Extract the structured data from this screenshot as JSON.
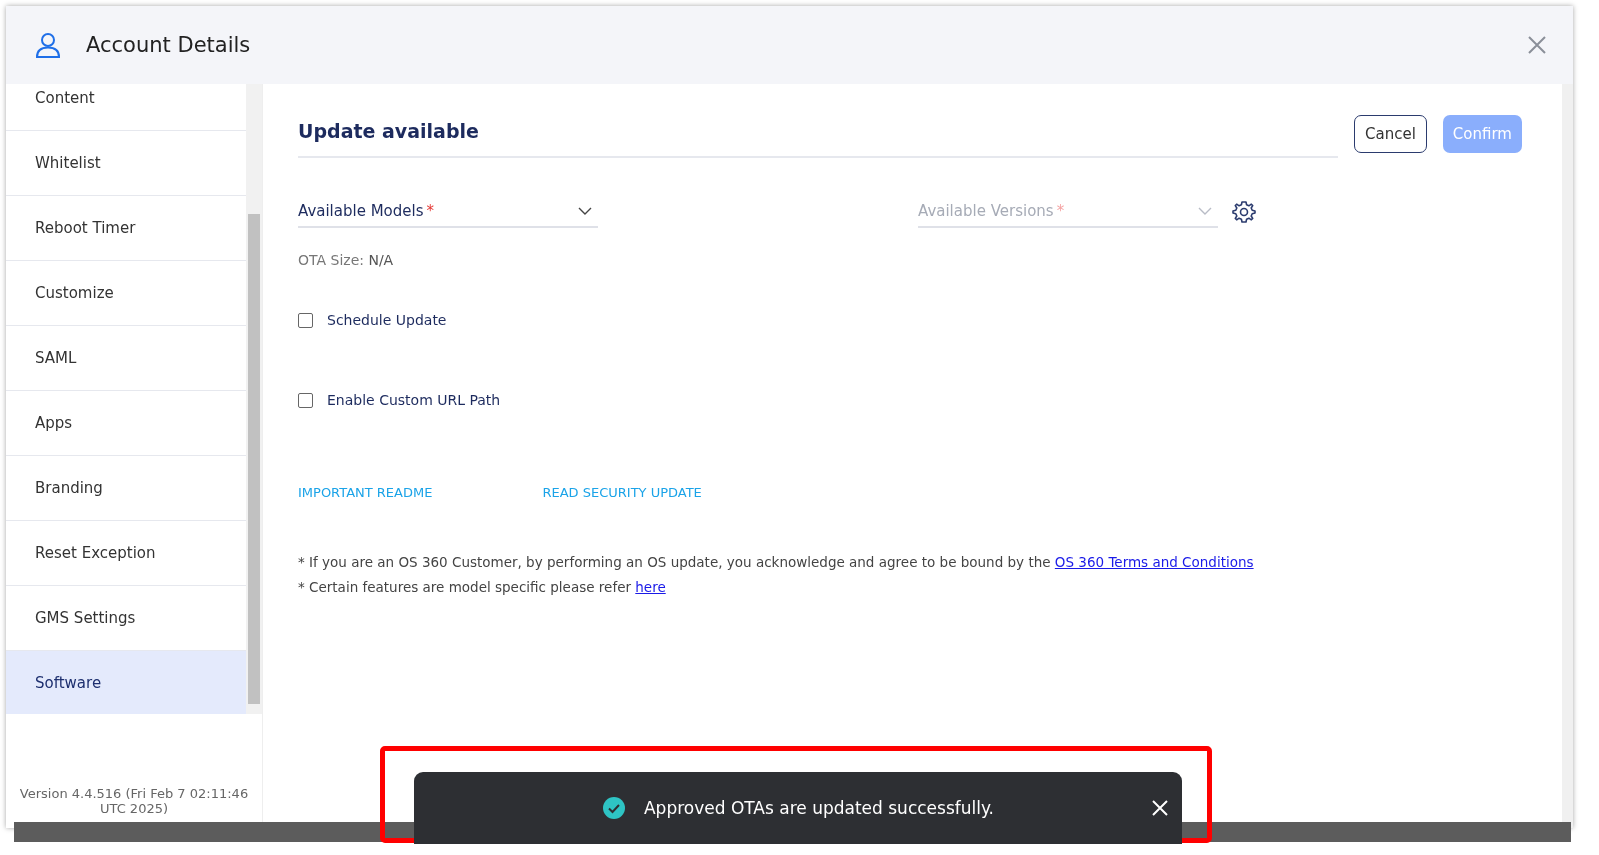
{
  "window": {
    "title": "Account Details"
  },
  "sidebar": {
    "items": [
      {
        "label": "Content",
        "selected": false
      },
      {
        "label": "Whitelist",
        "selected": false
      },
      {
        "label": "Reboot Timer",
        "selected": false
      },
      {
        "label": "Customize",
        "selected": false
      },
      {
        "label": "SAML",
        "selected": false
      },
      {
        "label": "Apps",
        "selected": false
      },
      {
        "label": "Branding",
        "selected": false
      },
      {
        "label": "Reset Exception",
        "selected": false
      },
      {
        "label": "GMS Settings",
        "selected": false
      },
      {
        "label": "Software",
        "selected": true
      }
    ],
    "version": "Version 4.4.516 (Fri Feb 7 02:11:46 UTC 2025)"
  },
  "main": {
    "title": "Update available",
    "buttons": [
      {
        "label": "Cancel",
        "disabled": false
      },
      {
        "label": "Confirm",
        "disabled": true
      }
    ],
    "selects": [
      {
        "placeholder": "Available Models",
        "required_mark": "*",
        "disabled": false
      },
      {
        "placeholder": "Available Versions",
        "required_mark": "*",
        "disabled": true
      }
    ],
    "ota_size": {
      "label": "OTA Size:",
      "value": "N/A"
    },
    "checkboxes": [
      {
        "label": "Schedule Update",
        "checked": false
      },
      {
        "label": "Enable Custom URL Path",
        "checked": false
      }
    ],
    "links": [
      "IMPORTANT README",
      "READ SECURITY UPDATE"
    ],
    "notes": [
      {
        "text": "* If you are an OS 360 Customer, by performing an OS update, you acknowledge and agree to be bound by the ",
        "link": "OS 360 Terms and Conditions"
      },
      {
        "text": "* Certain features are model specific please refer ",
        "link": "here"
      }
    ]
  },
  "toast": {
    "message": "Approved OTAs are updated successfully."
  }
}
